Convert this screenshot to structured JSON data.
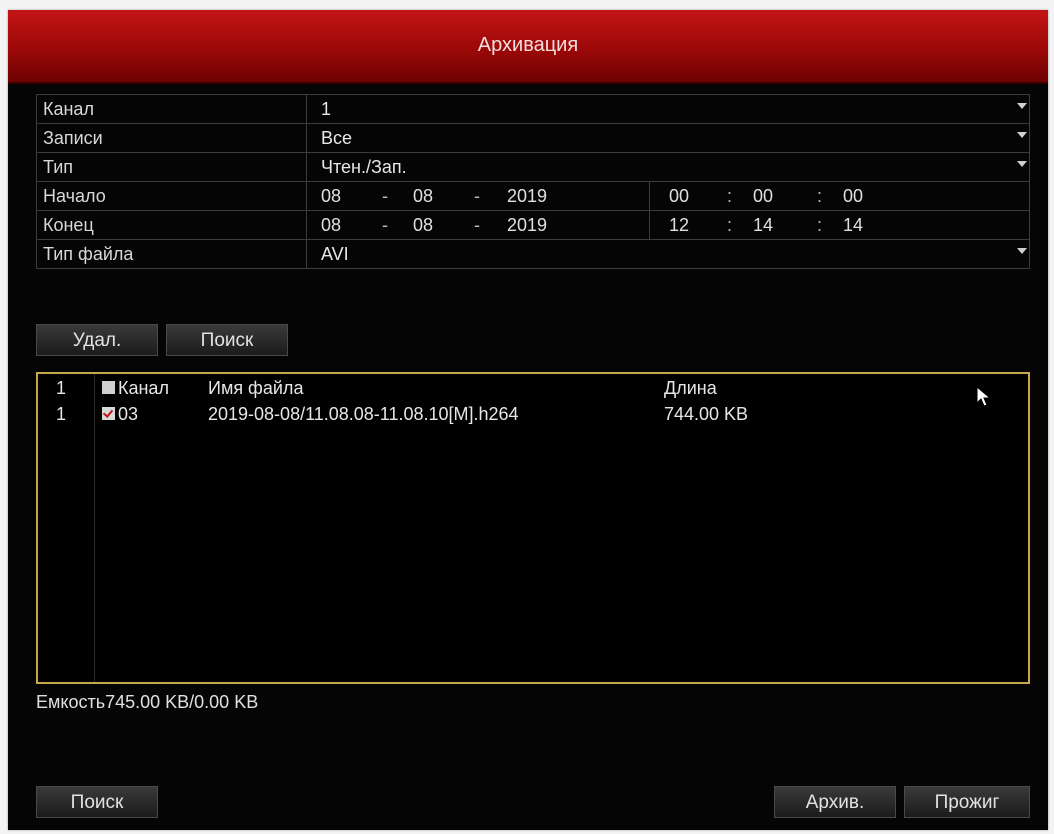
{
  "window": {
    "title": "Архивация"
  },
  "form": {
    "channel": {
      "label": "Канал",
      "value": "1"
    },
    "records": {
      "label": "Записи",
      "value": "Все"
    },
    "type": {
      "label": "Тип",
      "value": "Чтен./Зап."
    },
    "start": {
      "label": "Начало",
      "day": "08",
      "month": "08",
      "year": "2019",
      "hour": "00",
      "minute": "00",
      "second": "00"
    },
    "end": {
      "label": "Конец",
      "day": "08",
      "month": "08",
      "year": "2019",
      "hour": "12",
      "minute": "14",
      "second": "14"
    },
    "file_type": {
      "label": "Тип файла",
      "value": "AVI"
    },
    "date_sep": "-",
    "time_sep": ":"
  },
  "actions": {
    "delete": "Удал.",
    "search": "Поиск"
  },
  "file_list": {
    "header": {
      "index": "1",
      "channel": "Канал",
      "filename": "Имя файла",
      "length": "Длина"
    },
    "rows": [
      {
        "index": "1",
        "checked": true,
        "channel": "03",
        "filename": "2019-08-08/11.08.08-11.08.10[M].h264",
        "length": "744.00 KB"
      }
    ]
  },
  "capacity": {
    "label": "Емкость",
    "value": "745.00 KB/0.00 KB"
  },
  "footer": {
    "search": "Поиск",
    "archive": "Архив.",
    "burn": "Прожиг"
  },
  "colors": {
    "titlebar": "#b80f0f",
    "selection_border": "#c8a64a",
    "background": "#050505"
  }
}
